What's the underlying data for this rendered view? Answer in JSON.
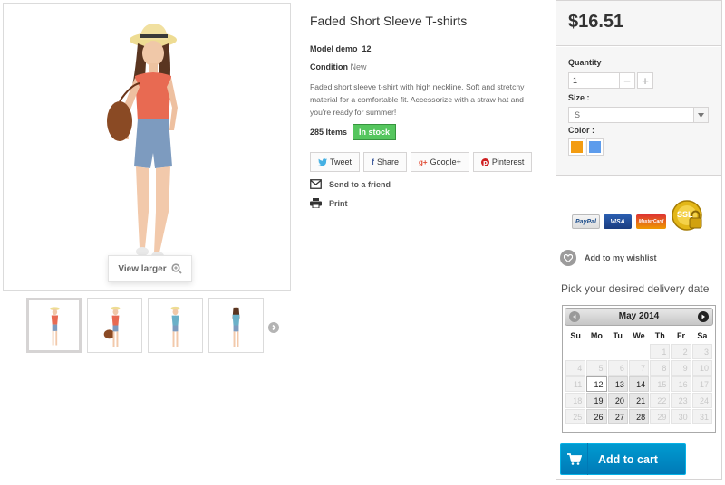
{
  "image": {
    "view_larger_label": "View larger",
    "thumbnails": [
      "thumb-1",
      "thumb-2",
      "thumb-3",
      "thumb-4"
    ]
  },
  "product": {
    "title": "Faded Short Sleeve T-shirts",
    "model_label": "Model",
    "model_value": "demo_12",
    "condition_label": "Condition",
    "condition_value": "New",
    "description": "Faded short sleeve t-shirt with high neckline. Soft and stretchy material for a comfortable fit. Accessorize with a straw hat and you're ready for summer!",
    "items_count": "285 Items",
    "stock_status": "In stock"
  },
  "social": {
    "tweet": "Tweet",
    "share": "Share",
    "google": "Google+",
    "pinterest": "Pinterest",
    "tweet_icon": "twitter-icon",
    "share_icon": "facebook-icon",
    "google_icon": "google-plus-icon",
    "pinterest_icon": "pinterest-icon"
  },
  "actions": {
    "send_to_friend": "Send to a friend",
    "print": "Print"
  },
  "buy": {
    "price": "$16.51",
    "quantity_label": "Quantity",
    "quantity_value": "1",
    "size_label": "Size :",
    "size_value": "S",
    "color_label": "Color :",
    "colors": [
      "#f39c11",
      "#5d9cec"
    ],
    "payment_cards": [
      "PayPal",
      "VISA",
      "MasterCard",
      "SSL"
    ],
    "wishlist": "Add to my wishlist",
    "delivery_prompt": "Pick your desired delivery date",
    "add_to_cart": "Add to cart"
  },
  "calendar": {
    "month": "May 2014",
    "weekdays": [
      "Su",
      "Mo",
      "Tu",
      "We",
      "Th",
      "Fr",
      "Sa"
    ],
    "weeks": [
      [
        "",
        "",
        "",
        "",
        "1",
        "2",
        "3"
      ],
      [
        "4",
        "5",
        "6",
        "7",
        "8",
        "9",
        "10"
      ],
      [
        "11",
        "12",
        "13",
        "14",
        "15",
        "16",
        "17"
      ],
      [
        "18",
        "19",
        "20",
        "21",
        "22",
        "23",
        "24"
      ],
      [
        "25",
        "26",
        "27",
        "28",
        "29",
        "30",
        "31"
      ]
    ],
    "available": [
      "12",
      "13",
      "14",
      "19",
      "20",
      "21",
      "26",
      "27",
      "28"
    ],
    "today": "12"
  },
  "colors": {
    "accent_blue": "#009ad0",
    "in_stock_green": "#55c65e"
  }
}
